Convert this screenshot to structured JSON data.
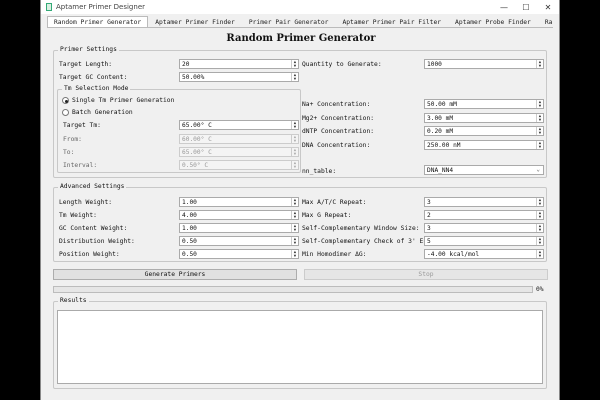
{
  "window": {
    "title": "Aptamer Primer Designer",
    "controls": [
      "—",
      "☐",
      "✕"
    ]
  },
  "tabs": [
    "Random Primer Generator",
    "Aptamer Primer Finder",
    "Primer Pair Generator",
    "Aptamer Primer Pair Filter",
    "Aptamer Probe Finder",
    "Random Prob"
  ],
  "page_title": "Random Primer Generator",
  "primer_settings": {
    "title": "Primer Settings",
    "target_length": {
      "label": "Target Length:",
      "value": "20"
    },
    "target_gc": {
      "label": "Target GC Content:",
      "value": "50.00%"
    },
    "quantity": {
      "label": "Quantity to Generate:",
      "value": "1000"
    },
    "tm_mode": {
      "title": "Tm Selection Mode",
      "single": "Single Tm Primer Generation",
      "batch": "Batch Generation",
      "target_tm": {
        "label": "Target Tm:",
        "value": "65.00° C"
      },
      "from": {
        "label": "From:",
        "value": "60.00° C"
      },
      "to": {
        "label": "To:",
        "value": "65.00° C"
      },
      "interval": {
        "label": "Interval:",
        "value": "0.50° C"
      }
    },
    "na": {
      "label": "Na+ Concentration:",
      "value": "50.00 mM"
    },
    "mg": {
      "label": "Mg2+ Concentration:",
      "value": "3.00 mM"
    },
    "dntp": {
      "label": "dNTP Concentration:",
      "value": "0.20 mM"
    },
    "dna": {
      "label": "DNA Concentration:",
      "value": "250.00 nM"
    },
    "nn_table": {
      "label": "nn_table:",
      "value": "DNA_NN4"
    }
  },
  "advanced_settings": {
    "title": "Advanced Settings",
    "length_weight": {
      "label": "Length Weight:",
      "value": "1.00"
    },
    "tm_weight": {
      "label": "Tm Weight:",
      "value": "4.00"
    },
    "gc_weight": {
      "label": "GC Content Weight:",
      "value": "1.00"
    },
    "dist_weight": {
      "label": "Distribution Weight:",
      "value": "0.50"
    },
    "pos_weight": {
      "label": "Position Weight:",
      "value": "0.50"
    },
    "max_atc": {
      "label": "Max A/T/C Repeat:",
      "value": "3"
    },
    "max_g": {
      "label": "Max G Repeat:",
      "value": "2"
    },
    "self_comp_window": {
      "label": "Self-Complementary Window Size:",
      "value": "3"
    },
    "self_comp_3end": {
      "label": "Self-Complementary Check of 3' End:",
      "value": "5"
    },
    "min_homodimer": {
      "label": "Min Homodimer ΔG:",
      "value": "-4.00 kcal/mol"
    }
  },
  "buttons": {
    "generate": "Generate Primers",
    "stop": "Stop"
  },
  "progress": {
    "value": 0,
    "label": "0%"
  },
  "results": {
    "title": "Results"
  }
}
